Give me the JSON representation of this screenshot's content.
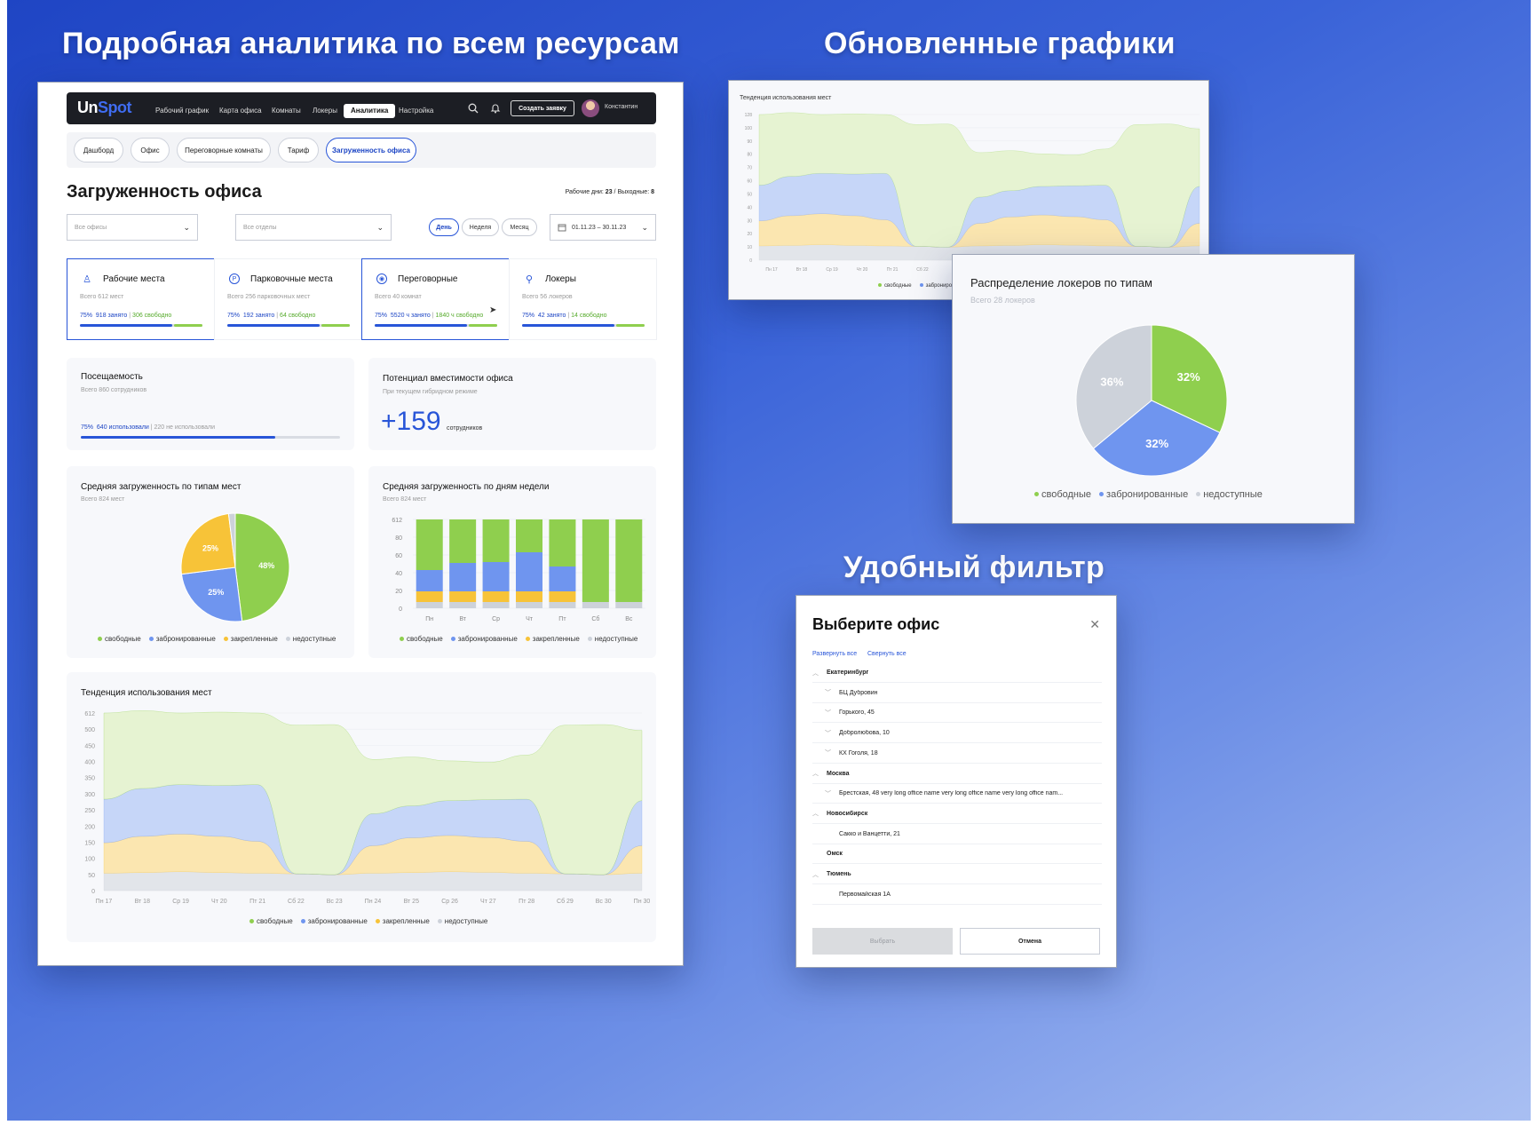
{
  "headings": {
    "left": "Подробная аналитика по всем ресурсам",
    "right_top": "Обновленные графики",
    "right_mid": "Удобный фильтр"
  },
  "colors": {
    "free": "#8fcf4e",
    "booked": "#6f95ef",
    "fixed": "#f7c338",
    "unavailable": "#cdd2da",
    "accent": "#2855d8",
    "navbar": "#1c1e24"
  },
  "app": {
    "logo_un": "Un",
    "logo_spot": "Spot",
    "nav": [
      "Рабочий график",
      "Карта офиса",
      "Комнаты",
      "Локеры",
      "Аналитика",
      "Настройка"
    ],
    "nav_active": "Аналитика",
    "create_button": "Создать заявку",
    "user_name": "Константин",
    "icons": [
      "search-icon",
      "bell-icon",
      "avatar"
    ]
  },
  "tabs": [
    "Дашборд",
    "Офис",
    "Переговорные комнаты",
    "Тариф",
    "Загруженность офиса"
  ],
  "page": {
    "title": "Загруженность офиса",
    "workdays_label": "Рабочие дни:",
    "workdays_value": "23",
    "separator": "/",
    "weekends_label": "Выходные:",
    "weekends_value": "8",
    "filter_offices": "Все офисы",
    "filter_departments": "Все отделы",
    "periods": [
      "День",
      "Неделя",
      "Месяц"
    ],
    "period_active": "День",
    "date_range": "01.11.23 – 30.11.23"
  },
  "resources": [
    {
      "title": "Рабочие места",
      "icon": "person-icon",
      "sub": "Всего 612 мест",
      "pct": "75%",
      "busy": "918 занято",
      "free": "306 свободно",
      "fill": 0.75,
      "selected": true
    },
    {
      "title": "Парковочные места",
      "icon": "parking-icon",
      "sub": "Всего 256 парковочных мест",
      "pct": "75%",
      "busy": "192 занято",
      "free": "64 свободно",
      "fill": 0.75,
      "selected": false
    },
    {
      "title": "Переговорные",
      "icon": "meeting-icon",
      "sub": "Всего 40 комнат",
      "pct": "75%",
      "busy": "5520 ч занято",
      "free": "1840 ч свободно",
      "fill": 0.75,
      "selected": true
    },
    {
      "title": "Локеры",
      "icon": "key-icon",
      "sub": "Всего 56 локеров",
      "pct": "75%",
      "busy": "42 занято",
      "free": "14 свободно",
      "fill": 0.75,
      "selected": false
    }
  ],
  "attendance": {
    "title": "Посещаемость",
    "sub": "Всего 860 сотрудников",
    "pct": "75%",
    "used": "640 использовали",
    "unused": "220 не использовали",
    "fill": 0.75
  },
  "capacity": {
    "title": "Потенциал вместимости офиса",
    "sub": "При текущем гибридном режиме",
    "value": "+159",
    "unit": "сотрудников"
  },
  "legend": [
    "свободные",
    "забронированные",
    "закрепленные",
    "недоступные"
  ],
  "legend_short": [
    "свободные",
    "забронированные",
    "недоступные"
  ],
  "chart_data": [
    {
      "type": "pie",
      "title": "Средняя загруженность по типам мест",
      "subtitle": "Всего 824 мест",
      "categories": [
        "свободные",
        "забронированные",
        "закрепленные",
        "недоступные"
      ],
      "values": [
        48,
        25,
        25,
        2
      ],
      "labels": [
        "48%",
        "25%",
        "25%",
        ""
      ]
    },
    {
      "type": "bar",
      "title": "Средняя загруженность по дням недели",
      "subtitle": "Всего 824 мест",
      "categories": [
        "Пн",
        "Вт",
        "Ср",
        "Чт",
        "Пт",
        "Сб",
        "Вс"
      ],
      "yticks": [
        "612",
        "80",
        "60",
        "40",
        "20",
        "0"
      ],
      "ylim": [
        0,
        100
      ],
      "series": [
        {
          "name": "недоступные",
          "values": [
            7,
            7,
            7,
            7,
            7,
            7,
            7
          ]
        },
        {
          "name": "закрепленные",
          "values": [
            12,
            12,
            12,
            12,
            12,
            0,
            0
          ]
        },
        {
          "name": "забронированные",
          "values": [
            24,
            32,
            33,
            44,
            28,
            0,
            0
          ]
        },
        {
          "name": "свободные",
          "values": [
            57,
            49,
            48,
            37,
            53,
            93,
            93
          ]
        }
      ]
    },
    {
      "type": "area",
      "title": "Тенденция использования мест",
      "x": [
        "Пн 17",
        "Вт 18",
        "Ср 19",
        "Чт 20",
        "Пт 21",
        "Сб 22",
        "Вс 23",
        "Пн 24",
        "Вт 25",
        "Ср 26",
        "Чт 27",
        "Пт 28",
        "Сб 29",
        "Вс 30",
        "Пн 30"
      ],
      "yticks": [
        "612",
        "500",
        "450",
        "400",
        "350",
        "300",
        "250",
        "200",
        "150",
        "100",
        "50",
        "0"
      ],
      "ylim": [
        0,
        612
      ],
      "series": [
        {
          "name": "недоступные",
          "values": [
            60,
            62,
            65,
            62,
            60,
            58,
            55,
            60,
            62,
            65,
            63,
            60,
            58,
            55,
            60
          ]
        },
        {
          "name": "закрепленные",
          "values": [
            105,
            125,
            130,
            125,
            110,
            0,
            0,
            95,
            120,
            125,
            120,
            110,
            0,
            0,
            95
          ]
        },
        {
          "name": "забронированные",
          "values": [
            150,
            165,
            170,
            175,
            195,
            0,
            0,
            110,
            110,
            120,
            130,
            145,
            0,
            0,
            155
          ]
        },
        {
          "name": "свободные",
          "values": [
            297,
            268,
            247,
            253,
            247,
            512,
            517,
            187,
            168,
            137,
            129,
            152,
            512,
            517,
            242
          ]
        }
      ]
    },
    {
      "type": "area",
      "title": "Тенденция использования мест",
      "x": [
        "Пн 17",
        "Вт 18",
        "Ср 19",
        "Чт 20",
        "Пт 21",
        "Сб 22"
      ],
      "yticks": [
        "128",
        "100",
        "90",
        "80",
        "70",
        "60",
        "50",
        "40",
        "30",
        "20",
        "10",
        "0"
      ],
      "ylim": [
        0,
        128
      ]
    },
    {
      "type": "pie",
      "title": "Распределение локеров по типам",
      "subtitle": "Всего 28 локеров",
      "categories": [
        "свободные",
        "забронированные",
        "недоступные"
      ],
      "values": [
        32,
        32,
        36
      ],
      "labels": [
        "32%",
        "32%",
        "36%"
      ]
    }
  ],
  "filter": {
    "title": "Выберите офис",
    "expand_all": "Развернуть все",
    "collapse_all": "Свернуть все",
    "items": [
      {
        "text": "Екатеринбург",
        "level": 0,
        "bold": true,
        "chevron": "up"
      },
      {
        "text": "БЦ Дубровин",
        "level": 1,
        "bold": false,
        "chevron": "down"
      },
      {
        "text": "Горького, 45",
        "level": 1,
        "bold": false,
        "chevron": "down"
      },
      {
        "text": "Добролюбова, 10",
        "level": 1,
        "bold": false,
        "chevron": "down"
      },
      {
        "text": "КХ Гоголя, 18",
        "level": 1,
        "bold": false,
        "chevron": "down"
      },
      {
        "text": "Москва",
        "level": 0,
        "bold": true,
        "chevron": "up"
      },
      {
        "text": "Брестская, 48 very long office name very long office name very long office nam...",
        "level": 1,
        "bold": false,
        "chevron": "down"
      },
      {
        "text": "Новосибирск",
        "level": 0,
        "bold": true,
        "chevron": "up"
      },
      {
        "text": "Сакко и Ванцетти, 21",
        "level": 1,
        "bold": false,
        "chevron": ""
      },
      {
        "text": "Омск",
        "level": 0,
        "bold": true,
        "chevron": ""
      },
      {
        "text": "Тюмень",
        "level": 0,
        "bold": true,
        "chevron": "up"
      },
      {
        "text": "Первомайская 1А",
        "level": 1,
        "bold": false,
        "chevron": ""
      }
    ],
    "select_button": "Выбрать",
    "cancel_button": "Отмена"
  }
}
